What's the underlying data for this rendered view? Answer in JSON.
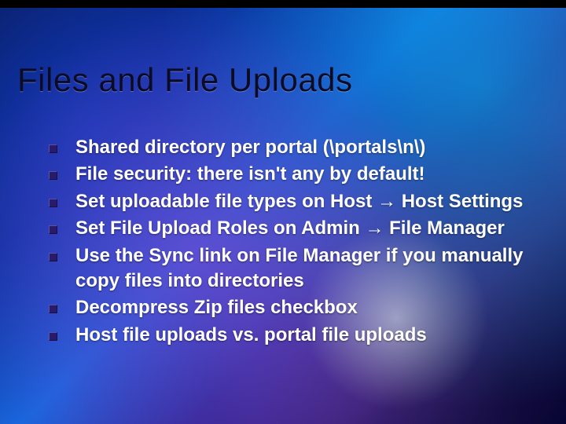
{
  "title": "Files and File Uploads",
  "bullets": [
    "Shared directory per portal (\\portals\\n\\)",
    "File security: there isn't any by default!",
    "Set uploadable file types on Host → Host Settings",
    "Set File Upload Roles on Admin → File Manager",
    "Use the Sync link on File Manager if you manually copy files into directories",
    "Decompress Zip files checkbox",
    "Host file uploads vs. portal file uploads"
  ]
}
